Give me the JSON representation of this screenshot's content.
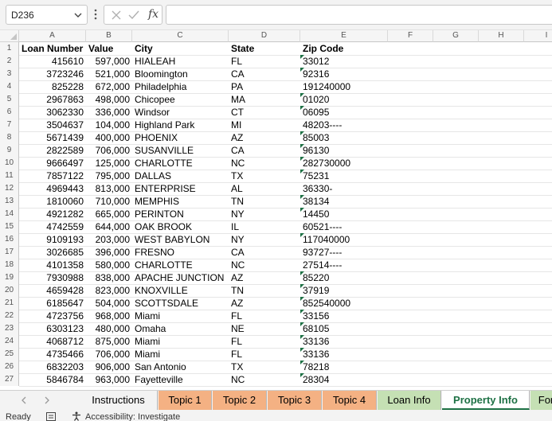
{
  "formula_bar": {
    "name_box": "D236",
    "cancel_icon": "x-icon",
    "enter_icon": "check-icon",
    "fx_label": "fx",
    "formula_value": ""
  },
  "columns": [
    "A",
    "B",
    "C",
    "D",
    "E",
    "F",
    "G",
    "H",
    "I"
  ],
  "headers": {
    "loan_number": "Loan Number",
    "value": "Value",
    "city": "City",
    "state": "State",
    "zip": "Zip Code"
  },
  "rows": [
    {
      "row": "2",
      "loan": "415610",
      "value": "597,000",
      "city": "HIALEAH",
      "state": "FL",
      "zip": "33012",
      "flag": true
    },
    {
      "row": "3",
      "loan": "3723246",
      "value": "521,000",
      "city": "Bloomington",
      "state": "CA",
      "zip": "92316",
      "flag": true
    },
    {
      "row": "4",
      "loan": "825228",
      "value": "672,000",
      "city": "Philadelphia",
      "state": "PA",
      "zip": "191240000",
      "flag": false
    },
    {
      "row": "5",
      "loan": "2967863",
      "value": "498,000",
      "city": "Chicopee",
      "state": "MA",
      "zip": "01020",
      "flag": true
    },
    {
      "row": "6",
      "loan": "3062330",
      "value": "336,000",
      "city": "Windsor",
      "state": "CT",
      "zip": "06095",
      "flag": true
    },
    {
      "row": "7",
      "loan": "3504637",
      "value": "104,000",
      "city": "Highland Park",
      "state": "MI",
      "zip": "48203----",
      "flag": false
    },
    {
      "row": "8",
      "loan": "5671439",
      "value": "400,000",
      "city": "PHOENIX",
      "state": "AZ",
      "zip": "85003",
      "flag": true
    },
    {
      "row": "9",
      "loan": "2822589",
      "value": "706,000",
      "city": "SUSANVILLE",
      "state": "CA",
      "zip": "96130",
      "flag": true
    },
    {
      "row": "10",
      "loan": "9666497",
      "value": "125,000",
      "city": "CHARLOTTE",
      "state": "NC",
      "zip": "282730000",
      "flag": true
    },
    {
      "row": "11",
      "loan": "7857122",
      "value": "795,000",
      "city": "DALLAS",
      "state": "TX",
      "zip": "75231",
      "flag": true
    },
    {
      "row": "12",
      "loan": "4969443",
      "value": "813,000",
      "city": "ENTERPRISE",
      "state": "AL",
      "zip": "36330-",
      "flag": false
    },
    {
      "row": "13",
      "loan": "1810060",
      "value": "710,000",
      "city": "MEMPHIS",
      "state": "TN",
      "zip": "38134",
      "flag": true
    },
    {
      "row": "14",
      "loan": "4921282",
      "value": "665,000",
      "city": "PERINTON",
      "state": "NY",
      "zip": "14450",
      "flag": true
    },
    {
      "row": "15",
      "loan": "4742559",
      "value": "644,000",
      "city": "OAK BROOK",
      "state": "IL",
      "zip": "60521----",
      "flag": false
    },
    {
      "row": "16",
      "loan": "9109193",
      "value": "203,000",
      "city": "WEST BABYLON",
      "state": "NY",
      "zip": "117040000",
      "flag": true
    },
    {
      "row": "17",
      "loan": "3026685",
      "value": "396,000",
      "city": "FRESNO",
      "state": "CA",
      "zip": "93727----",
      "flag": false
    },
    {
      "row": "18",
      "loan": "4101358",
      "value": "580,000",
      "city": "CHARLOTTE",
      "state": "NC",
      "zip": "27514----",
      "flag": false
    },
    {
      "row": "19",
      "loan": "7930988",
      "value": "838,000",
      "city": "APACHE JUNCTION",
      "state": "AZ",
      "zip": "85220",
      "flag": true
    },
    {
      "row": "20",
      "loan": "4659428",
      "value": "823,000",
      "city": "KNOXVILLE",
      "state": "TN",
      "zip": "37919",
      "flag": true
    },
    {
      "row": "21",
      "loan": "6185647",
      "value": "504,000",
      "city": "SCOTTSDALE",
      "state": "AZ",
      "zip": "852540000",
      "flag": true
    },
    {
      "row": "22",
      "loan": "4723756",
      "value": "968,000",
      "city": "Miami",
      "state": "FL",
      "zip": "33156",
      "flag": true
    },
    {
      "row": "23",
      "loan": "6303123",
      "value": "480,000",
      "city": "Omaha",
      "state": "NE",
      "zip": "68105",
      "flag": true
    },
    {
      "row": "24",
      "loan": "4068712",
      "value": "875,000",
      "city": "Miami",
      "state": "FL",
      "zip": "33136",
      "flag": true
    },
    {
      "row": "25",
      "loan": "4735466",
      "value": "706,000",
      "city": "Miami",
      "state": "FL",
      "zip": "33136",
      "flag": true
    },
    {
      "row": "26",
      "loan": "6832203",
      "value": "906,000",
      "city": "San Antonio",
      "state": "TX",
      "zip": "78218",
      "flag": true
    },
    {
      "row": "27",
      "loan": "5846784",
      "value": "963,000",
      "city": "Fayetteville",
      "state": "NC",
      "zip": "28304",
      "flag": true
    }
  ],
  "sheet_tabs": [
    {
      "label": "Instructions",
      "color": "#f3f3f3",
      "active": false
    },
    {
      "label": "Topic 1",
      "color": "#f4b183",
      "active": false
    },
    {
      "label": "Topic 2",
      "color": "#f4b183",
      "active": false
    },
    {
      "label": "Topic 3",
      "color": "#f4b183",
      "active": false
    },
    {
      "label": "Topic 4",
      "color": "#f4b183",
      "active": false
    },
    {
      "label": "Loan Info",
      "color": "#c5e0b4",
      "active": false
    },
    {
      "label": "Property Info",
      "color": "#ffffff",
      "active": true
    },
    {
      "label": "For",
      "color": "#c5e0b4",
      "active": false
    }
  ],
  "status": {
    "ready": "Ready",
    "accessibility": "Accessibility: Investigate"
  },
  "colors": {
    "accent": "#1e7145",
    "gridline": "#e6e6e6",
    "header_bg": "#f5f5f5"
  }
}
